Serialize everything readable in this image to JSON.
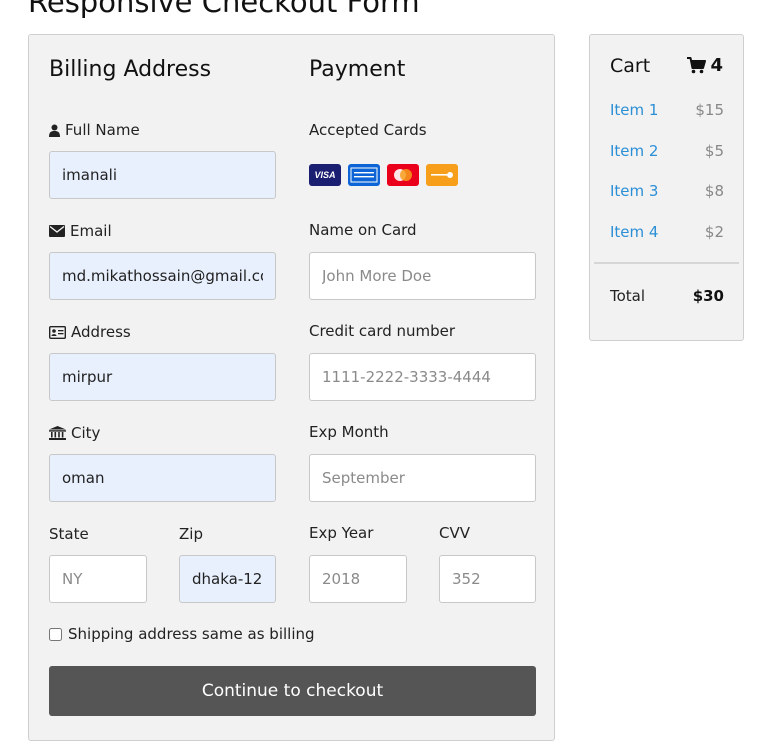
{
  "page": {
    "title": "Responsive Checkout Form"
  },
  "billing": {
    "heading": "Billing Address",
    "full_name": {
      "label": "Full Name",
      "value": "imanali"
    },
    "email": {
      "label": "Email",
      "value": "md.mikathossain@gmail.com"
    },
    "address": {
      "label": "Address",
      "value": "mirpur"
    },
    "city": {
      "label": "City",
      "value": "oman"
    },
    "state": {
      "label": "State",
      "placeholder": "NY"
    },
    "zip": {
      "label": "Zip",
      "value": "dhaka-12"
    }
  },
  "payment": {
    "heading": "Payment",
    "accepted_cards_label": "Accepted Cards",
    "cards": [
      {
        "name": "VISA",
        "color": "#1a1f71"
      },
      {
        "name": "AMEX",
        "color": "#0d64d6"
      },
      {
        "name": "MasterCard",
        "color": "#eb001b"
      },
      {
        "name": "DISCOVER",
        "color": "#f79e1b"
      }
    ],
    "name_on_card": {
      "label": "Name on Card",
      "placeholder": "John More Doe"
    },
    "card_number": {
      "label": "Credit card number",
      "placeholder": "1111-2222-3333-4444"
    },
    "exp_month": {
      "label": "Exp Month",
      "placeholder": "September"
    },
    "exp_year": {
      "label": "Exp Year",
      "placeholder": "2018"
    },
    "cvv": {
      "label": "CVV",
      "placeholder": "352"
    }
  },
  "shipping_checkbox": {
    "label": "Shipping address same as billing",
    "checked": false
  },
  "submit": {
    "label": "Continue to checkout",
    "color": "#555555"
  },
  "cart": {
    "title": "Cart",
    "count": "4",
    "items": [
      {
        "name": "Item 1",
        "price": "$15"
      },
      {
        "name": "Item 2",
        "price": "$5"
      },
      {
        "name": "Item 3",
        "price": "$8"
      },
      {
        "name": "Item 4",
        "price": "$2"
      }
    ],
    "total_label": "Total",
    "total_value": "$30"
  },
  "icons": {
    "full_name": "user-icon",
    "email": "envelope-icon",
    "address": "address-card-icon",
    "city": "institution-icon",
    "cart": "shopping-cart-icon"
  },
  "colors": {
    "link": "#2b8fd6",
    "autofill_bg": "#e8f0fe",
    "panel_bg": "#f2f2f2"
  }
}
